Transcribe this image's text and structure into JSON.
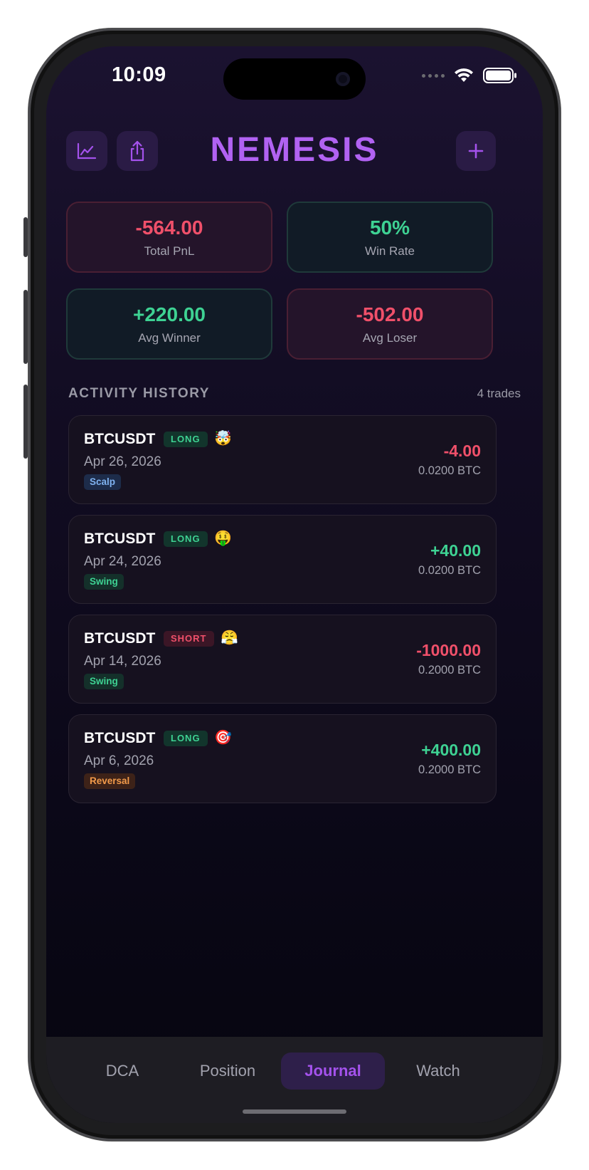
{
  "status": {
    "time": "10:09"
  },
  "header": {
    "title": "NEMESIS"
  },
  "stats": {
    "total_pnl": {
      "value": "-564.00",
      "label": "Total PnL"
    },
    "win_rate": {
      "value": "50%",
      "label": "Win Rate"
    },
    "avg_winner": {
      "value": "+220.00",
      "label": "Avg Winner"
    },
    "avg_loser": {
      "value": "-502.00",
      "label": "Avg Loser"
    }
  },
  "activity": {
    "heading": "ACTIVITY HISTORY",
    "count": "4 trades",
    "trades": [
      {
        "symbol": "BTCUSDT",
        "side": "LONG",
        "emoji": "🤯",
        "date": "Apr 26, 2026",
        "tag": "Scalp",
        "pnl": "-4.00",
        "qty": "0.0200 BTC"
      },
      {
        "symbol": "BTCUSDT",
        "side": "LONG",
        "emoji": "🤑",
        "date": "Apr 24, 2026",
        "tag": "Swing",
        "pnl": "+40.00",
        "qty": "0.0200 BTC"
      },
      {
        "symbol": "BTCUSDT",
        "side": "SHORT",
        "emoji": "😤",
        "date": "Apr 14, 2026",
        "tag": "Swing",
        "pnl": "-1000.00",
        "qty": "0.2000 BTC"
      },
      {
        "symbol": "BTCUSDT",
        "side": "LONG",
        "emoji": "🎯",
        "date": "Apr 6, 2026",
        "tag": "Reversal",
        "pnl": "+400.00",
        "qty": "0.2000 BTC"
      }
    ]
  },
  "tabs": [
    {
      "label": "DCA"
    },
    {
      "label": "Position"
    },
    {
      "label": "Journal",
      "active": true
    },
    {
      "label": "Watch"
    }
  ],
  "colors": {
    "accent": "#b162f2",
    "positive": "#3ed293",
    "negative": "#f0506a",
    "background": "#0b0818"
  }
}
